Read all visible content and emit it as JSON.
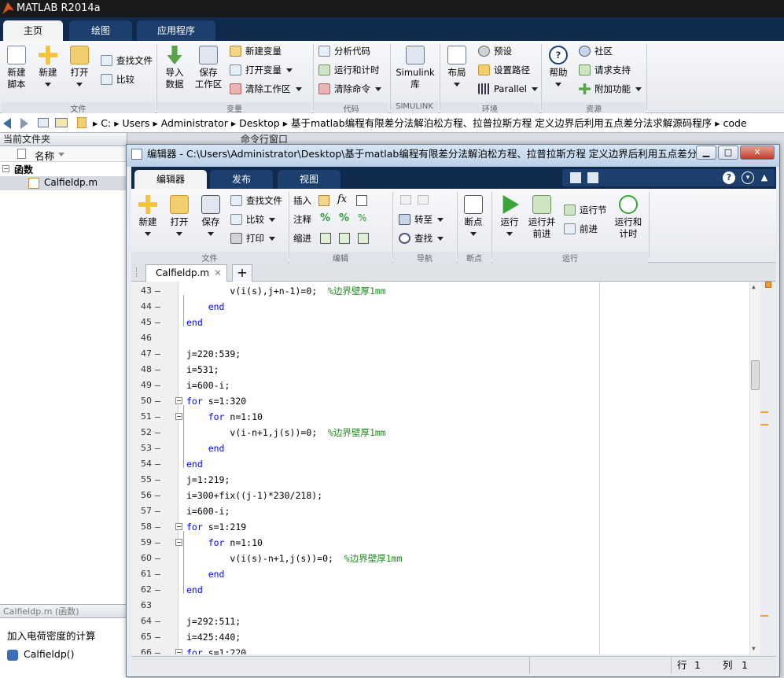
{
  "app": {
    "title": "MATLAB R2014a"
  },
  "main_tabs": [
    "主页",
    "绘图",
    "应用程序"
  ],
  "ribbon": {
    "new_script": "新建\n脚本",
    "new": "新建",
    "open": "打开",
    "find_files": "查找文件",
    "compare": "比较",
    "import_data": "导入\n数据",
    "save_workspace": "保存\n工作区",
    "new_variable": "新建变量",
    "open_variable": "打开变量",
    "clear_workspace": "清除工作区",
    "analyze_code": "分析代码",
    "run_and_time": "运行和计时",
    "clear_commands": "清除命令",
    "simulink": "Simulink\n库",
    "layout": "布局",
    "preferences": "预设",
    "set_path": "设置路径",
    "parallel": "Parallel",
    "help": "帮助",
    "community": "社区",
    "request_support": "请求支持",
    "add_ons": "附加功能",
    "groups": [
      "文件",
      "变量",
      "代码",
      "SIMULINK",
      "环境",
      "资源"
    ]
  },
  "address": {
    "crumbs": [
      "C:",
      "Users",
      "Administrator",
      "Desktop",
      "基于matlab编程有限差分法解泊松方程、拉普拉斯方程 定义边界后利用五点差分法求解源码程序",
      "code"
    ]
  },
  "current_folder": {
    "header": "当前文件夹",
    "column_name": "名称",
    "group_label": "函数",
    "file": "Calfieldp.m"
  },
  "command_window": {
    "header": "命令行窗口"
  },
  "details": {
    "title": "Calfieldp.m",
    "type": "(函数)",
    "description": "加入电荷密度的计算",
    "function_sig": "Calfieldp()"
  },
  "editor": {
    "title": "编辑器 - C:\\Users\\Administrator\\Desktop\\基于matlab编程有限差分法解泊松方程、拉普拉斯方程 定义边界后利用五点差分...",
    "tabs": [
      "编辑器",
      "发布",
      "视图"
    ],
    "ribbon": {
      "new": "新建",
      "open": "打开",
      "save": "保存",
      "find_files": "查找文件",
      "compare": "比较",
      "print": "打印",
      "insert": "插入",
      "comment": "注释",
      "indent": "缩进",
      "goto": "转至",
      "find": "查找",
      "breakpoints": "断点",
      "run": "运行",
      "run_advance": "运行并\n前进",
      "run_section": "运行节",
      "advance": "前进",
      "run_and_time": "运行和\n计时",
      "groups": [
        "文件",
        "编辑",
        "导航",
        "断点",
        "运行"
      ]
    },
    "file_tab": "Calfieldp.m",
    "lines": [
      {
        "n": "43",
        "indent": "        ",
        "parts": [
          {
            "t": "v(i(s),j+n-1)=0;  "
          },
          {
            "t": "%边界壁厚1mm",
            "c": "cm"
          }
        ]
      },
      {
        "n": "44",
        "indent": "    ",
        "parts": [
          {
            "t": "end",
            "c": "kw"
          }
        ]
      },
      {
        "n": "45",
        "indent": "",
        "parts": [
          {
            "t": "end",
            "c": "kw"
          }
        ]
      },
      {
        "n": "46",
        "indent": "",
        "parts": []
      },
      {
        "n": "47",
        "indent": "",
        "parts": [
          {
            "t": "j=220:539;"
          }
        ]
      },
      {
        "n": "48",
        "indent": "",
        "parts": [
          {
            "t": "i=531;"
          }
        ]
      },
      {
        "n": "49",
        "indent": "",
        "parts": [
          {
            "t": "i=600-i;"
          }
        ]
      },
      {
        "n": "50",
        "indent": "",
        "parts": [
          {
            "t": "for",
            "c": "kw"
          },
          {
            "t": " s=1:320"
          }
        ]
      },
      {
        "n": "51",
        "indent": "    ",
        "parts": [
          {
            "t": "for",
            "c": "kw"
          },
          {
            "t": " n=1:10"
          }
        ]
      },
      {
        "n": "52",
        "indent": "        ",
        "parts": [
          {
            "t": "v(i-n+1,j(s))=0;  "
          },
          {
            "t": "%边界壁厚1mm",
            "c": "cm"
          }
        ]
      },
      {
        "n": "53",
        "indent": "    ",
        "parts": [
          {
            "t": "end",
            "c": "kw"
          }
        ]
      },
      {
        "n": "54",
        "indent": "",
        "parts": [
          {
            "t": "end",
            "c": "kw"
          }
        ]
      },
      {
        "n": "55",
        "indent": "",
        "parts": [
          {
            "t": "j=1:219;"
          }
        ]
      },
      {
        "n": "56",
        "indent": "",
        "parts": [
          {
            "t": "i=300+fix((j-1)*230/218);"
          }
        ]
      },
      {
        "n": "57",
        "indent": "",
        "parts": [
          {
            "t": "i=600-i;"
          }
        ]
      },
      {
        "n": "58",
        "indent": "",
        "parts": [
          {
            "t": "for",
            "c": "kw"
          },
          {
            "t": " s=1:219"
          }
        ]
      },
      {
        "n": "59",
        "indent": "    ",
        "parts": [
          {
            "t": "for",
            "c": "kw"
          },
          {
            "t": " n=1:10"
          }
        ]
      },
      {
        "n": "60",
        "indent": "        ",
        "parts": [
          {
            "t": "v(i(s)-n+1,j(s))=0;  "
          },
          {
            "t": "%边界壁厚1mm",
            "c": "cm"
          }
        ]
      },
      {
        "n": "61",
        "indent": "    ",
        "parts": [
          {
            "t": "end",
            "c": "kw"
          }
        ]
      },
      {
        "n": "62",
        "indent": "",
        "parts": [
          {
            "t": "end",
            "c": "kw"
          }
        ]
      },
      {
        "n": "63",
        "indent": "",
        "parts": []
      },
      {
        "n": "64",
        "indent": "",
        "parts": [
          {
            "t": "j=292:511;"
          }
        ]
      },
      {
        "n": "65",
        "indent": "",
        "parts": [
          {
            "t": "i=425:440;"
          }
        ]
      },
      {
        "n": "66",
        "indent": "",
        "parts": [
          {
            "t": "for",
            "c": "kw"
          },
          {
            "t": " s=1:220"
          }
        ]
      }
    ],
    "status": {
      "row_label": "行",
      "row": "1",
      "col_label": "列",
      "col": "1"
    }
  },
  "colors": {
    "keyword": "#0000ff",
    "comment": "#228b22",
    "tabstrip": "#0f2a4c"
  },
  "icons": [
    "new-script-icon",
    "plus-icon",
    "folder-icon",
    "save-icon",
    "run-icon",
    "help-icon",
    "back-arrow-icon",
    "forward-arrow-icon"
  ]
}
